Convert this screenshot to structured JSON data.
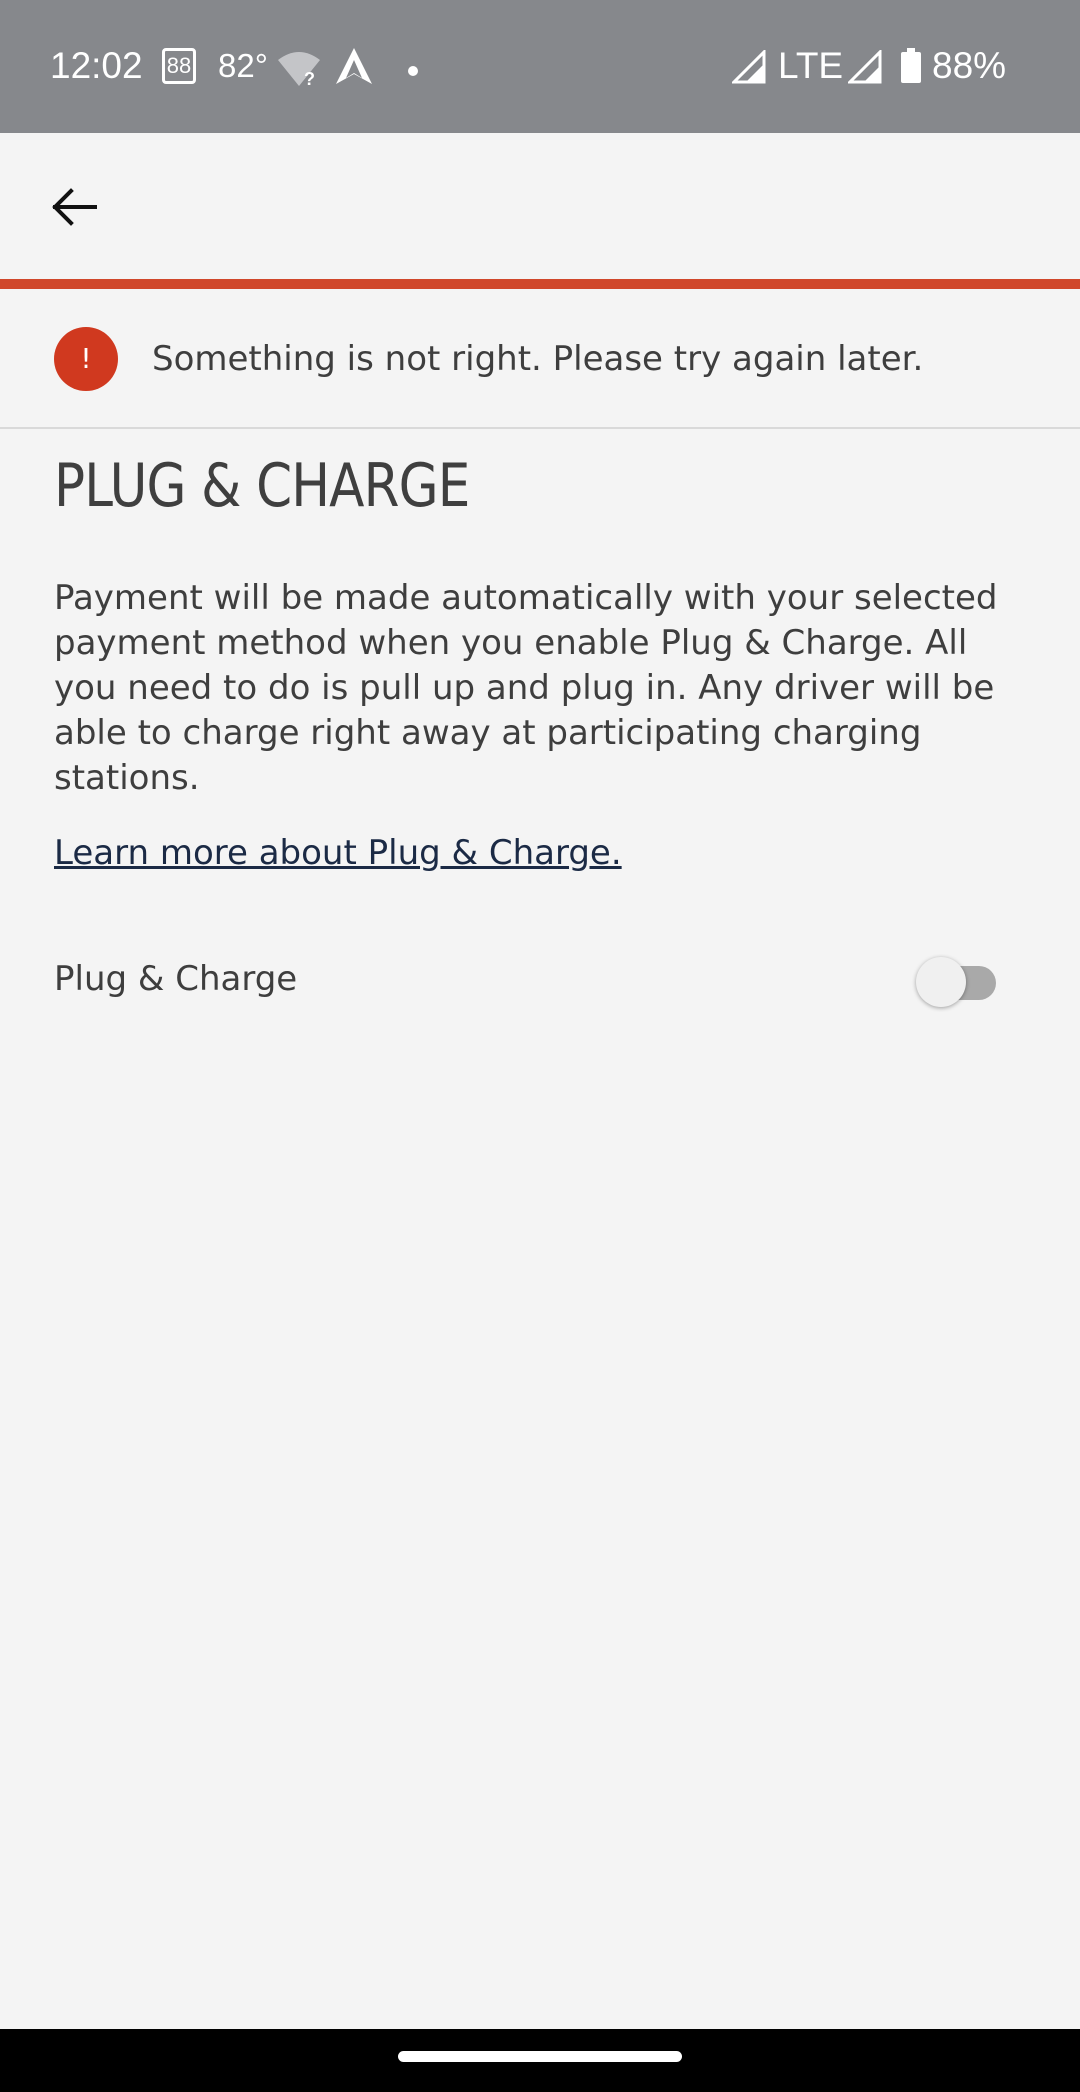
{
  "status_bar": {
    "time": "12:02",
    "badge": "88",
    "temperature": "82°",
    "network": "LTE",
    "battery": "88%",
    "icons": [
      "wifi-question-icon",
      "navigation-arrow-icon",
      "notification-dot-icon",
      "signal-icon",
      "battery-icon"
    ]
  },
  "app_bar": {
    "back_icon": "arrow-left-icon"
  },
  "error_banner": {
    "icon": "exclamation-icon",
    "icon_glyph": "!",
    "message": "Something is not right. Please try again later.",
    "accent_color": "#d0472b"
  },
  "main": {
    "title": "PLUG & CHARGE",
    "description": "Payment will be made automatically with your selected payment method when you enable Plug & Charge. All you need to do is pull up and plug in. Any driver will be able to charge right away at participating charging stations.",
    "learn_more_link": "Learn more about Plug & Charge.",
    "toggle": {
      "label": "Plug & Charge",
      "enabled": false
    }
  },
  "colors": {
    "background": "#f4f4f4",
    "status_bar": "#86888c",
    "error": "#d0391f",
    "link": "#1b2a45",
    "text": "#3e3e3e"
  }
}
